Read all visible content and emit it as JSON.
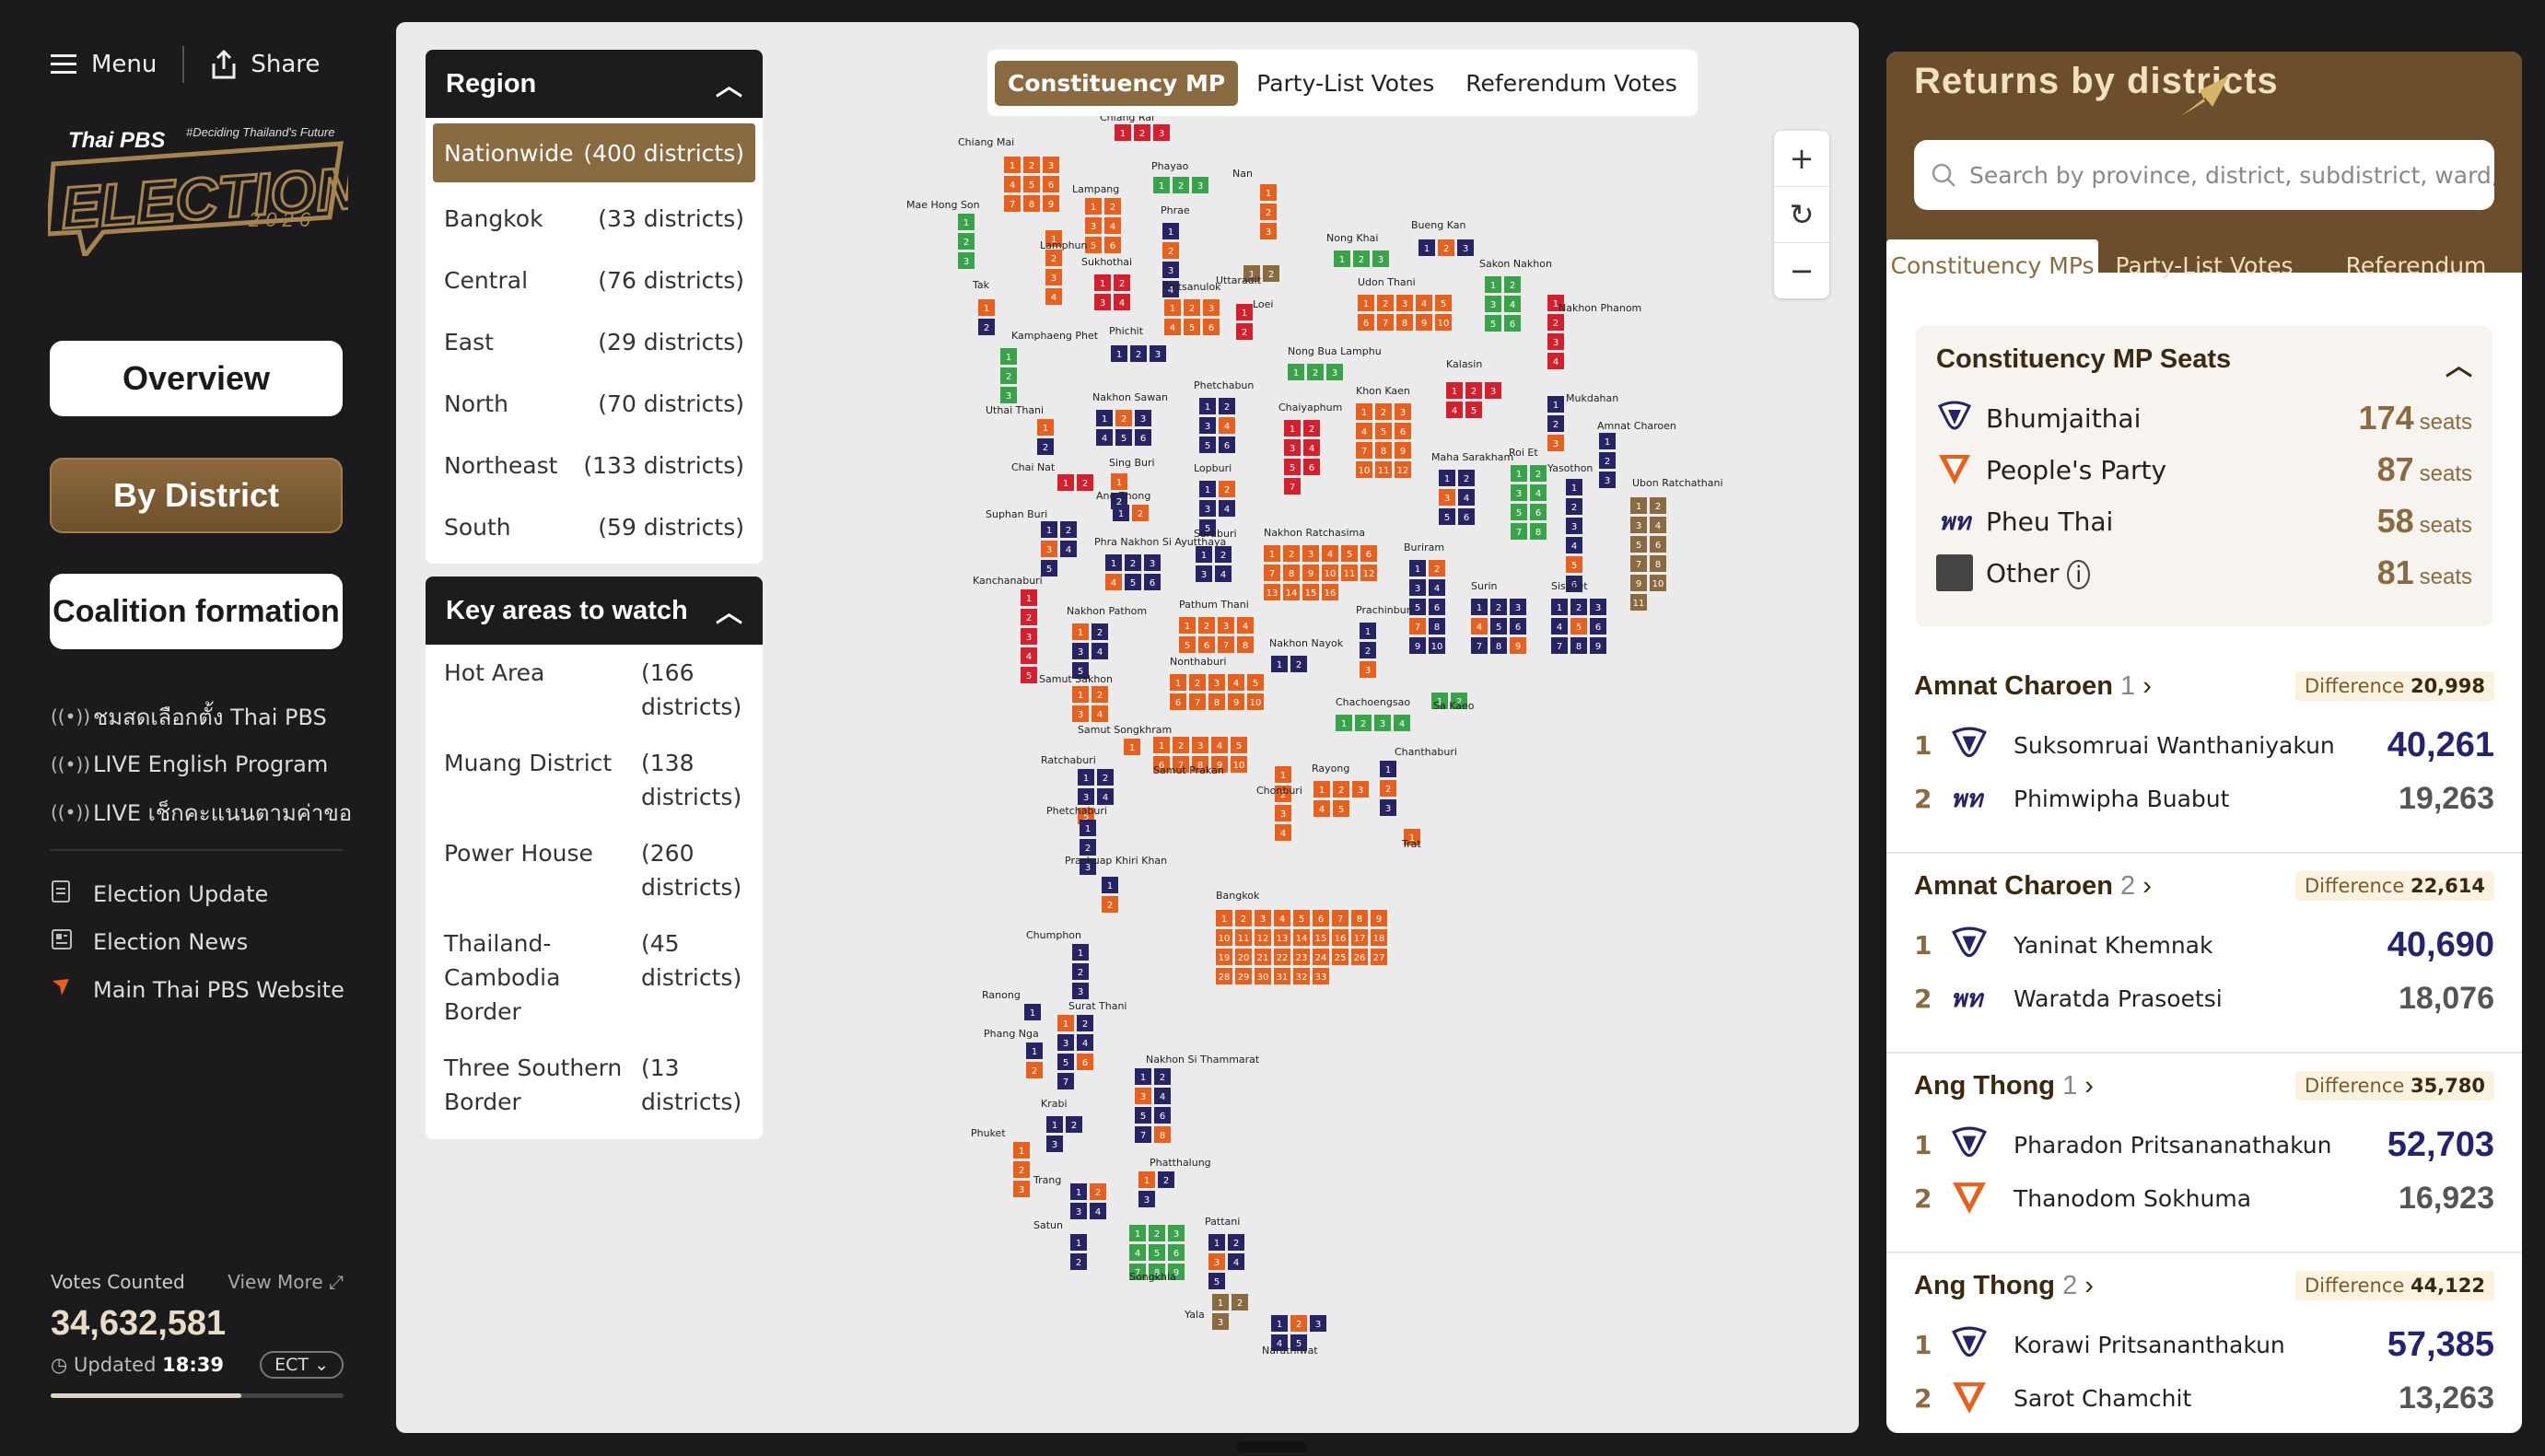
{
  "topbar": {
    "menu_label": "Menu",
    "share_label": "Share"
  },
  "logo": {
    "brand": "Thai PBS",
    "tagline": "#Deciding Thailand's Future",
    "word": "ELECTION",
    "year": "2026"
  },
  "nav": {
    "overview": "Overview",
    "by_district": "By District",
    "coalition": "Coalition formation"
  },
  "live_links": [
    "ชมสดเลือกตั้ง Thai PBS",
    "LIVE English Program",
    "LIVE เช็กคะแนนตามค่าขอ"
  ],
  "links": [
    "Election Update",
    "Election News",
    "Main Thai PBS Website"
  ],
  "votes": {
    "label": "Votes Counted",
    "view_more": "View More",
    "count": "34,632,581",
    "updated_label": "Updated",
    "updated_time": "18:39",
    "source": "ECT",
    "progress": 0.65
  },
  "region": {
    "title": "Region",
    "items": [
      {
        "name": "Nationwide",
        "count": "(400 districts)"
      },
      {
        "name": "Bangkok",
        "count": "(33 districts)"
      },
      {
        "name": "Central",
        "count": "(76 districts)"
      },
      {
        "name": "East",
        "count": "(29 districts)"
      },
      {
        "name": "North",
        "count": "(70 districts)"
      },
      {
        "name": "Northeast",
        "count": "(133 districts)"
      },
      {
        "name": "South",
        "count": "(59 districts)"
      }
    ]
  },
  "key_areas": {
    "title": "Key areas to watch",
    "items": [
      {
        "name": "Hot Area",
        "count": "(166 districts)"
      },
      {
        "name": "Muang District",
        "count": "(138 districts)"
      },
      {
        "name": "Power House",
        "count": "(260 districts)"
      },
      {
        "name": "Thailand-Cambodia Border",
        "count": "(45 districts)"
      },
      {
        "name": "Three Southern Border",
        "count": "(13 districts)"
      }
    ]
  },
  "map_tabs": [
    "Constituency MP",
    "Party-List Votes",
    "Referendum Votes"
  ],
  "colors": {
    "bhumjaithai": "#272464",
    "peoples": "#e4611f",
    "pheuthai": "#d3202f",
    "other": "#444444",
    "green": "#3aa24b",
    "brown": "#8a6a41",
    "cyan": "#1a9bd7"
  },
  "map_provinces": [
    {
      "name": "Chiang Rai"
    },
    {
      "name": "Chiang Mai"
    },
    {
      "name": "Phayao"
    },
    {
      "name": "Nan"
    },
    {
      "name": "Mae Hong Son"
    },
    {
      "name": "Lampang"
    },
    {
      "name": "Phrae"
    },
    {
      "name": "Lamphun"
    },
    {
      "name": "Sukhothai"
    },
    {
      "name": "Uttaradit"
    },
    {
      "name": "Nong Khai"
    },
    {
      "name": "Bueng Kan"
    },
    {
      "name": "Sakon Nakhon"
    },
    {
      "name": "Nakhon Phanom"
    },
    {
      "name": "Udon Thani"
    },
    {
      "name": "Tak"
    },
    {
      "name": "Phitsanulok"
    },
    {
      "name": "Loei"
    },
    {
      "name": "Kamphaeng Phet"
    },
    {
      "name": "Phichit"
    },
    {
      "name": "Nong Bua Lamphu"
    },
    {
      "name": "Kalasin"
    },
    {
      "name": "Mukdahan"
    },
    {
      "name": "Phetchabun"
    },
    {
      "name": "Khon Kaen"
    },
    {
      "name": "Uthai Thani"
    },
    {
      "name": "Nakhon Sawan"
    },
    {
      "name": "Chaiyaphum"
    },
    {
      "name": "Amnat Charoen"
    },
    {
      "name": "Chai Nat"
    },
    {
      "name": "Sing Buri"
    },
    {
      "name": "Lopburi"
    },
    {
      "name": "Maha Sarakham"
    },
    {
      "name": "Roi Et"
    },
    {
      "name": "Yasothon"
    },
    {
      "name": "Ubon Ratchathani"
    },
    {
      "name": "Ang Thong"
    },
    {
      "name": "Suphan Buri"
    },
    {
      "name": "Phra Nakhon Si Ayutthaya"
    },
    {
      "name": "Saraburi"
    },
    {
      "name": "Nakhon Ratchasima"
    },
    {
      "name": "Buriram"
    },
    {
      "name": "Kanchanaburi"
    },
    {
      "name": "Surin"
    },
    {
      "name": "Sisaket"
    },
    {
      "name": "Nakhon Pathom"
    },
    {
      "name": "Pathum Thani"
    },
    {
      "name": "Prachinburi"
    },
    {
      "name": "Nakhon Nayok"
    },
    {
      "name": "Nonthaburi"
    },
    {
      "name": "Samut Sakhon"
    },
    {
      "name": "Chachoengsao"
    },
    {
      "name": "Sa Kaeo"
    },
    {
      "name": "Samut Songkhram"
    },
    {
      "name": "Ratchaburi"
    },
    {
      "name": "Samut Prakan"
    },
    {
      "name": "Chanthaburi"
    },
    {
      "name": "Rayong"
    },
    {
      "name": "Chonburi"
    },
    {
      "name": "Phetchaburi"
    },
    {
      "name": "Trat"
    },
    {
      "name": "Prachuap Khiri Khan"
    },
    {
      "name": "Bangkok"
    },
    {
      "name": "Chumphon"
    },
    {
      "name": "Ranong"
    },
    {
      "name": "Surat Thani"
    },
    {
      "name": "Phang Nga"
    },
    {
      "name": "Nakhon Si Thammarat"
    },
    {
      "name": "Krabi"
    },
    {
      "name": "Phuket"
    },
    {
      "name": "Phatthalung"
    },
    {
      "name": "Trang"
    },
    {
      "name": "Pattani"
    },
    {
      "name": "Satun"
    },
    {
      "name": "Songkhla"
    },
    {
      "name": "Yala"
    },
    {
      "name": "Narathiwat"
    }
  ],
  "right": {
    "title": "Returns by districts",
    "search_placeholder": "Search by province, district, subdistrict, ward, tambon",
    "tabs": [
      "Constituency MPs",
      "Party-List Votes",
      "Referendum"
    ],
    "seats_title": "Constituency MP Seats",
    "seat_unit": "seats",
    "parties": [
      {
        "name": "Bhumjaithai",
        "seats": "174"
      },
      {
        "name": "People's Party",
        "seats": "87"
      },
      {
        "name": "Pheu Thai",
        "seats": "58"
      },
      {
        "name": "Other",
        "seats": "81"
      }
    ],
    "diff_label": "Difference",
    "districts": [
      {
        "province": "Amnat Charoen",
        "no": "1",
        "diff": "20,998",
        "c1": {
          "rank": "1",
          "name": "Suksomruai Wanthaniyakun",
          "votes": "40,261"
        },
        "c2": {
          "rank": "2",
          "name": "Phimwipha Buabut",
          "votes": "19,263"
        }
      },
      {
        "province": "Amnat Charoen",
        "no": "2",
        "diff": "22,614",
        "c1": {
          "rank": "1",
          "name": "Yaninat Khemnak",
          "votes": "40,690"
        },
        "c2": {
          "rank": "2",
          "name": "Waratda Prasoetsi",
          "votes": "18,076"
        }
      },
      {
        "province": "Ang Thong",
        "no": "1",
        "diff": "35,780",
        "c1": {
          "rank": "1",
          "name": "Pharadon Pritsananathakun",
          "votes": "52,703"
        },
        "c2": {
          "rank": "2",
          "name": "Thanodom Sokhuma",
          "votes": "16,923"
        }
      },
      {
        "province": "Ang Thong",
        "no": "2",
        "diff": "44,122",
        "c1": {
          "rank": "1",
          "name": "Korawi Pritsananthakun",
          "votes": "57,385"
        },
        "c2": {
          "rank": "2",
          "name": "Sarot Chamchit",
          "votes": "13,263"
        }
      }
    ]
  }
}
